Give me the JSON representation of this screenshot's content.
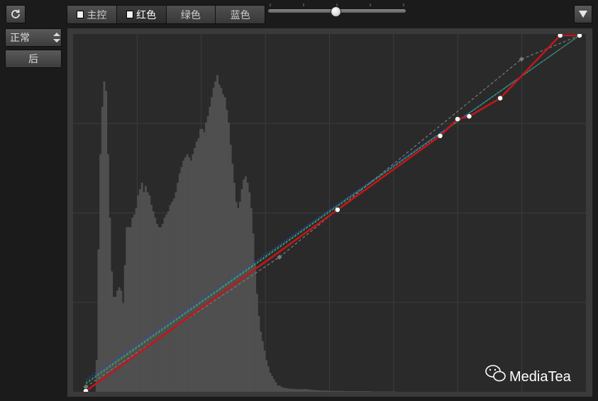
{
  "toolbar": {
    "reset_icon": "refresh-icon",
    "blend_mode": "正常",
    "after_label": "后",
    "menu_icon": "down-triangle-icon"
  },
  "channels": [
    {
      "label": "主控",
      "active": false
    },
    {
      "label": "红色",
      "active": true
    },
    {
      "label": "绿色",
      "active": false
    },
    {
      "label": "蓝色",
      "active": false
    }
  ],
  "slider": {
    "value": 0.49
  },
  "watermark": {
    "text": "MediaTea",
    "icon": "wechat-icon"
  },
  "chart_data": {
    "type": "line",
    "x_range": [
      0,
      255
    ],
    "y_range": [
      0,
      255
    ],
    "grid": true,
    "curves": [
      {
        "name": "red",
        "color": "#c2161b",
        "points": [
          [
            0,
            0
          ],
          [
            130,
            130
          ],
          [
            183,
            183
          ],
          [
            192,
            195
          ],
          [
            198,
            197
          ],
          [
            214,
            210
          ],
          [
            245,
            255
          ],
          [
            255,
            255
          ]
        ]
      },
      {
        "name": "master",
        "color": "#7a7a7a",
        "points": [
          [
            0,
            3
          ],
          [
            100,
            96
          ],
          [
            225,
            238
          ],
          [
            255,
            255
          ]
        ]
      },
      {
        "name": "green",
        "color": "#3aa63a",
        "points": [
          [
            0,
            5
          ],
          [
            255,
            255
          ]
        ]
      },
      {
        "name": "blue",
        "color": "#2e46d8",
        "points": [
          [
            0,
            8
          ],
          [
            255,
            255
          ]
        ]
      },
      {
        "name": "cyan",
        "color": "#35a6a6",
        "points": [
          [
            0,
            6
          ],
          [
            255,
            255
          ]
        ]
      }
    ],
    "histogram": [
      0,
      0,
      0,
      0,
      0,
      0,
      0,
      0,
      0,
      0,
      0,
      0,
      10,
      45,
      75,
      90,
      98,
      95,
      75,
      55,
      38,
      30,
      30,
      32,
      33,
      32,
      28,
      40,
      52,
      52,
      52,
      55,
      56,
      58,
      62,
      64,
      66,
      63,
      65,
      63,
      62,
      59,
      57,
      55,
      53,
      52,
      52,
      53,
      55,
      56,
      57,
      59,
      60,
      61,
      63,
      66,
      69,
      71,
      73,
      74,
      75,
      74,
      73,
      75,
      77,
      79,
      80,
      83,
      83,
      82,
      85,
      87,
      90,
      93,
      96,
      98,
      100,
      97,
      96,
      94,
      93,
      89,
      85,
      78,
      72,
      66,
      60,
      58,
      60,
      64,
      67,
      68,
      66,
      63,
      58,
      50,
      40,
      31,
      24,
      19,
      16,
      13,
      10,
      8,
      6,
      5,
      4,
      3,
      2,
      2,
      1.5,
      1.3,
      1.2,
      1.1,
      1,
      1,
      0.9,
      0.9,
      0.8,
      0.8,
      0.8,
      0.8,
      0.9,
      0.9,
      0.8,
      0.7,
      0.6,
      0.6,
      0.5,
      0.5,
      0.4,
      0.4,
      0.4,
      0.4,
      0.4,
      0.3,
      0.3,
      0.3,
      0.3,
      0.3,
      0.3,
      0.3,
      0.3,
      0.2,
      0.2,
      0.2,
      0.2,
      0.2,
      0.2,
      0.2,
      0.2,
      0.2,
      0.2,
      0.2,
      0.2,
      0.2,
      0.2,
      0.2,
      0.1,
      0.1,
      0.1,
      0.1,
      0.1,
      0.1,
      0.1,
      0.1,
      0.1,
      0.1,
      0.1,
      0.1,
      0.1,
      0,
      0,
      0,
      0,
      0,
      0,
      0,
      0,
      0,
      0,
      0,
      0,
      0,
      0,
      0,
      0,
      0,
      0,
      0,
      0,
      0,
      0,
      0,
      0,
      0,
      0,
      0,
      0,
      0,
      0,
      0,
      0,
      0,
      0,
      0,
      0,
      0,
      0,
      0,
      0,
      0,
      0,
      0,
      0,
      0,
      0,
      0,
      0,
      0,
      0,
      0,
      0,
      0,
      0,
      0,
      0,
      0,
      0,
      0,
      0,
      0,
      0,
      0,
      0,
      0,
      0,
      0,
      0,
      0,
      0,
      0,
      0,
      0,
      0,
      0,
      0,
      0,
      0,
      0,
      0,
      0,
      0,
      0,
      0,
      0,
      0,
      0,
      0,
      0,
      0,
      0,
      0,
      0,
      0,
      0,
      0,
      0,
      0,
      0,
      0,
      0
    ]
  }
}
